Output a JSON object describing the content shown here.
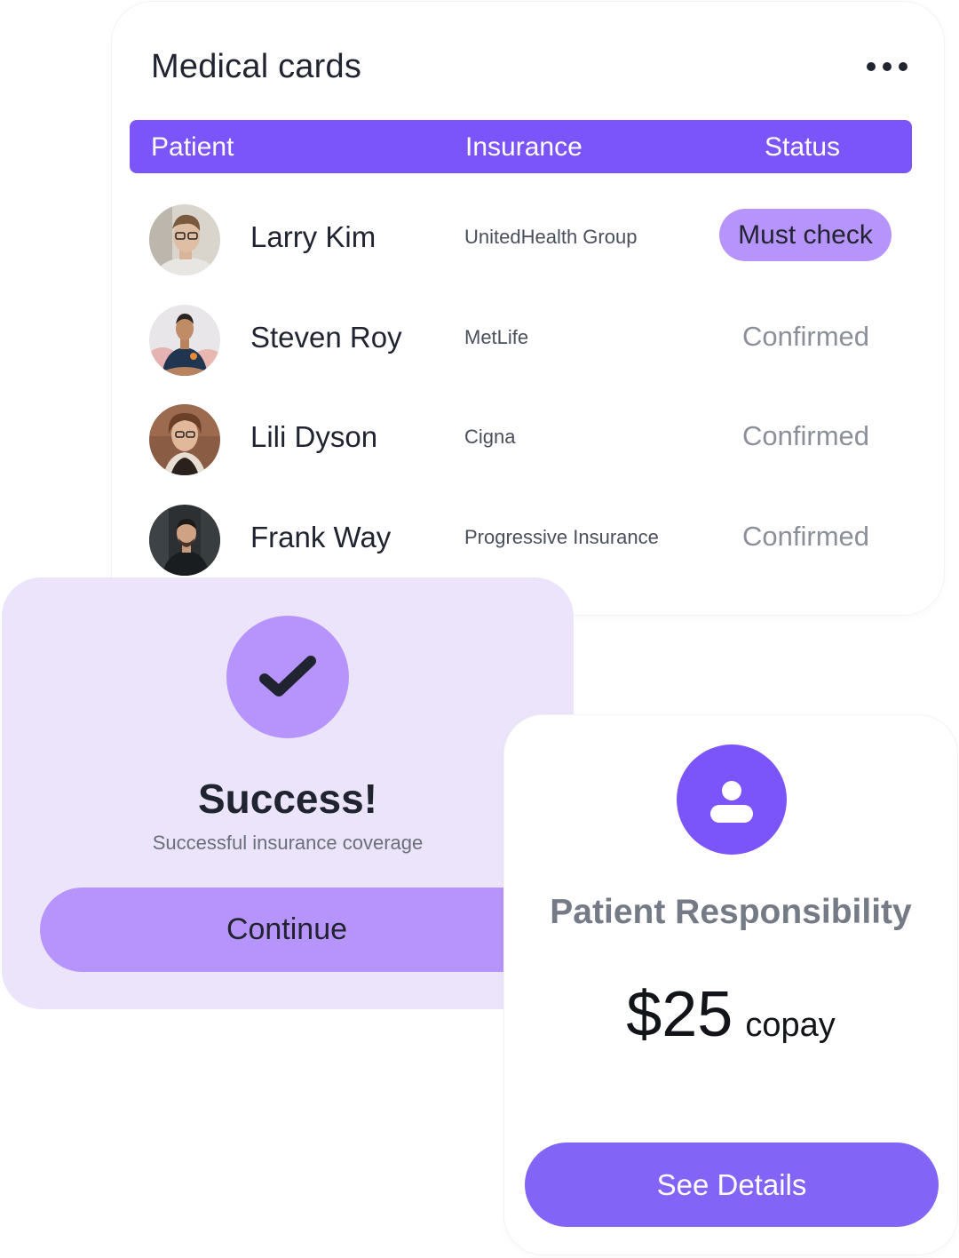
{
  "colors": {
    "primary": "#7b55f9",
    "primary_light": "#b794fb",
    "success_bg": "#ece4fa",
    "text_dark": "#1f2430",
    "text_muted": "#8a8f99"
  },
  "medical_cards": {
    "title": "Medical cards",
    "more_icon": "more-horizontal-icon",
    "columns": {
      "patient": "Patient",
      "insurance": "Insurance",
      "status": "Status"
    },
    "rows": [
      {
        "name": "Larry Kim",
        "insurance": "UnitedHealth Group",
        "status": "Must check"
      },
      {
        "name": "Steven Roy",
        "insurance": "MetLife",
        "status": "Confirmed"
      },
      {
        "name": "Lili Dyson",
        "insurance": "Cigna",
        "status": "Confirmed"
      },
      {
        "name": "Frank Way",
        "insurance": "Progressive Insurance",
        "status": "Confirmed"
      }
    ]
  },
  "success_card": {
    "icon": "checkmark-icon",
    "title": "Success!",
    "subtitle": "Successful insurance coverage",
    "button_label": "Continue"
  },
  "responsibility_card": {
    "icon": "user-icon",
    "title": "Patient Responsibility",
    "amount": "$25",
    "amount_unit": "copay",
    "button_label": "See Details"
  }
}
